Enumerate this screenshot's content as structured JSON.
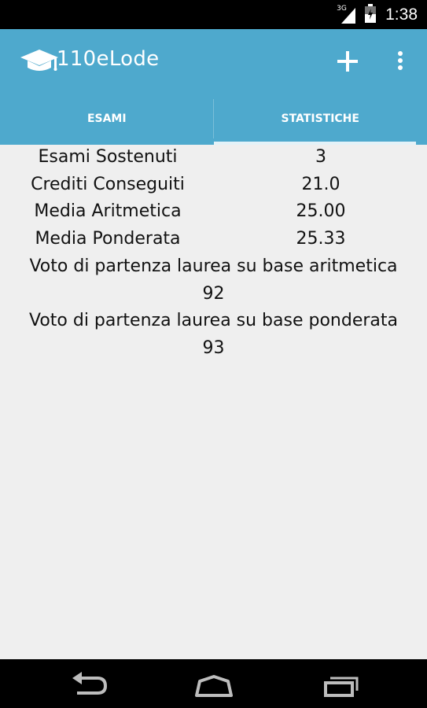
{
  "status_bar": {
    "network_type": "3G",
    "time": "1:38",
    "icons": [
      "signal-icon",
      "battery-icon"
    ]
  },
  "action_bar": {
    "app_title": "110eLode",
    "app_icon": "graduation-cap-icon",
    "add_icon": "plus-icon",
    "overflow_icon": "overflow-menu-icon"
  },
  "tabs": [
    {
      "label": "ESAMI",
      "selected": false
    },
    {
      "label": "STATISTICHE",
      "selected": true
    }
  ],
  "stats": {
    "rows": [
      {
        "label": "Esami Sostenuti",
        "value": "3"
      },
      {
        "label": "Crediti Conseguiti",
        "value": "21.0"
      },
      {
        "label": "Media Aritmetica",
        "value": "25.00"
      },
      {
        "label": "Media Ponderata",
        "value": "25.33"
      }
    ],
    "arithmetic_label": "Voto di partenza laurea su base aritmetica",
    "arithmetic_value": "92",
    "weighted_label": "Voto di partenza laurea su base ponderata",
    "weighted_value": "93"
  },
  "nav_bar": {
    "icons": [
      "back-icon",
      "home-icon",
      "recent-apps-icon"
    ]
  },
  "colors": {
    "action_bar": "#4ea9cd",
    "content_background": "#efefef",
    "system_bars": "#000000"
  }
}
